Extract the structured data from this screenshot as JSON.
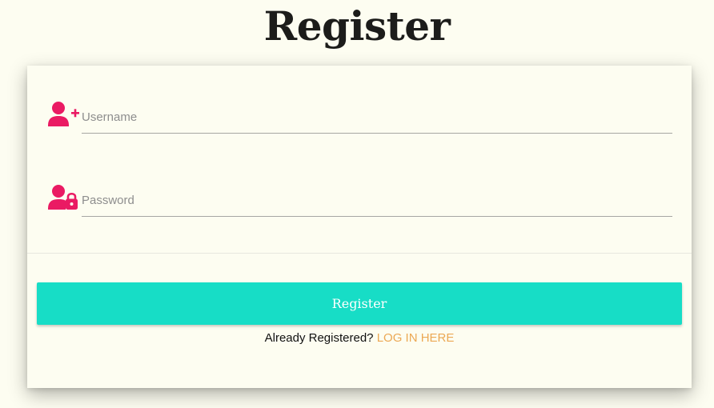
{
  "page": {
    "title": "Register"
  },
  "form": {
    "username": {
      "placeholder": "Username",
      "value": "",
      "icon": "user-plus-icon"
    },
    "password": {
      "placeholder": "Password",
      "value": "",
      "icon": "user-lock-icon"
    },
    "submit_label": "Register",
    "already_registered_text": "Already Registered?",
    "login_link_label": "LOG IN HERE"
  },
  "colors": {
    "background": "#fdfdf1",
    "icon": "#ea1a63",
    "button": "#17ddc6",
    "link": "#eca854",
    "title": "#1c1c1a"
  }
}
